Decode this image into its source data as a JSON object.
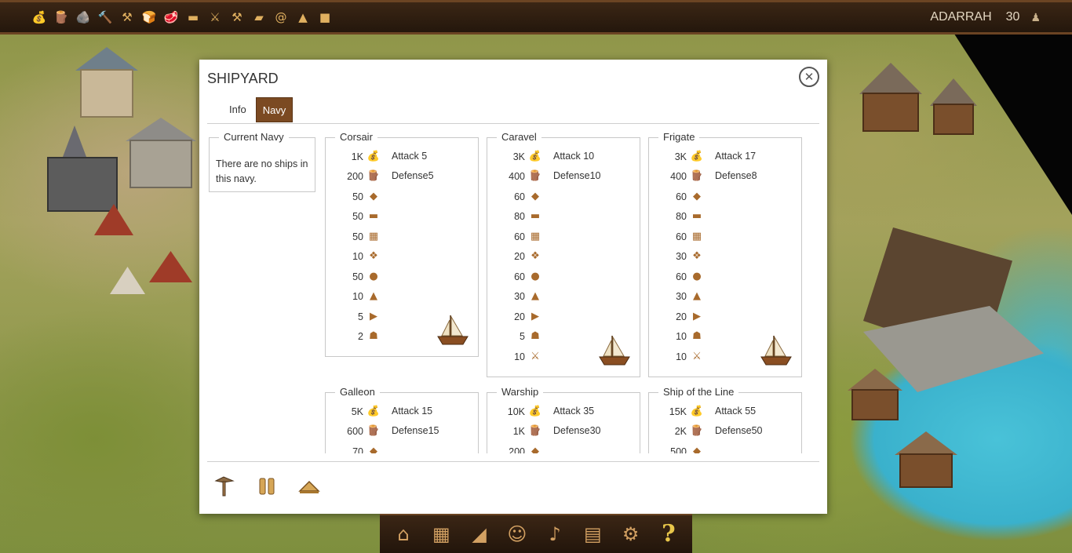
{
  "topbar": {
    "resource_icons": [
      {
        "name": "gold-icon",
        "glyph": "💰"
      },
      {
        "name": "wood-icon",
        "glyph": "🪵"
      },
      {
        "name": "stone-icon",
        "glyph": "🪨"
      },
      {
        "name": "tools-icon",
        "glyph": "🔨"
      },
      {
        "name": "iron-icon",
        "glyph": "⚒"
      },
      {
        "name": "bread-icon",
        "glyph": "🍞"
      },
      {
        "name": "meat-icon",
        "glyph": "🥩"
      },
      {
        "name": "plank-icon",
        "glyph": "▬"
      },
      {
        "name": "swords-icon",
        "glyph": "⚔"
      },
      {
        "name": "hammer-icon",
        "glyph": "⚒"
      },
      {
        "name": "gold-bar-icon",
        "glyph": "▰"
      },
      {
        "name": "rope-icon",
        "glyph": "@"
      },
      {
        "name": "salt-icon",
        "glyph": "▲"
      },
      {
        "name": "coal-icon",
        "glyph": "■"
      }
    ],
    "player_name": "ADARRAH",
    "player_level": "30"
  },
  "dialog": {
    "title": "SHIPYARD",
    "close_symbol": "✕",
    "tabs": [
      {
        "label": "Info",
        "active": false
      },
      {
        "label": "Navy",
        "active": true
      }
    ],
    "current_navy": {
      "heading": "Current Navy",
      "message": "There are no ships in this navy."
    },
    "ships": [
      {
        "name": "Corsair",
        "attack_label": "Attack",
        "attack": "5",
        "defense_label": "Defense",
        "defense": "5",
        "costs": [
          "1K",
          "200",
          "50",
          "50",
          "50",
          "10",
          "50",
          "10",
          "5",
          "2"
        ]
      },
      {
        "name": "Caravel",
        "attack_label": "Attack",
        "attack": "10",
        "defense_label": "Defense",
        "defense": "10",
        "costs": [
          "3K",
          "400",
          "60",
          "80",
          "60",
          "20",
          "60",
          "30",
          "20",
          "5",
          "10"
        ]
      },
      {
        "name": "Frigate",
        "attack_label": "Attack",
        "attack": "17",
        "defense_label": "Defense",
        "defense": "8",
        "costs": [
          "3K",
          "400",
          "60",
          "80",
          "60",
          "30",
          "60",
          "30",
          "20",
          "10",
          "10"
        ]
      },
      {
        "name": "Galleon",
        "attack_label": "Attack",
        "attack": "15",
        "defense_label": "Defense",
        "defense": "15",
        "costs": [
          "5K",
          "600",
          "70"
        ]
      },
      {
        "name": "Warship",
        "attack_label": "Attack",
        "attack": "35",
        "defense_label": "Defense",
        "defense": "30",
        "costs": [
          "10K",
          "1K",
          "200"
        ]
      },
      {
        "name": "Ship of the Line",
        "attack_label": "Attack",
        "attack": "55",
        "defense_label": "Defense",
        "defense": "50",
        "costs": [
          "15K",
          "2K",
          "500"
        ]
      }
    ],
    "cost_icons": [
      "gold-icon",
      "wood-icon",
      "stone-icon",
      "plank-icon",
      "crate-icon",
      "cloth-icon",
      "rock-icon",
      "sack-icon",
      "cannon-icon",
      "sailor-icon",
      "swords-icon"
    ],
    "cost_glyphs": [
      "💰",
      "🪵",
      "◆",
      "▬",
      "▦",
      "❖",
      "●",
      "▲",
      "▶",
      "☗",
      "⚔"
    ],
    "toolbar": [
      "build-hammer-icon",
      "pause-icon",
      "upgrade-arrow-icon"
    ]
  },
  "bottom_menu": [
    "town-hall-icon",
    "warehouse-icon",
    "horn-icon",
    "heroes-icon",
    "trumpet-icon",
    "map-scroll-icon",
    "siege-icon",
    "help-icon"
  ],
  "bottom_menu_help": "?"
}
